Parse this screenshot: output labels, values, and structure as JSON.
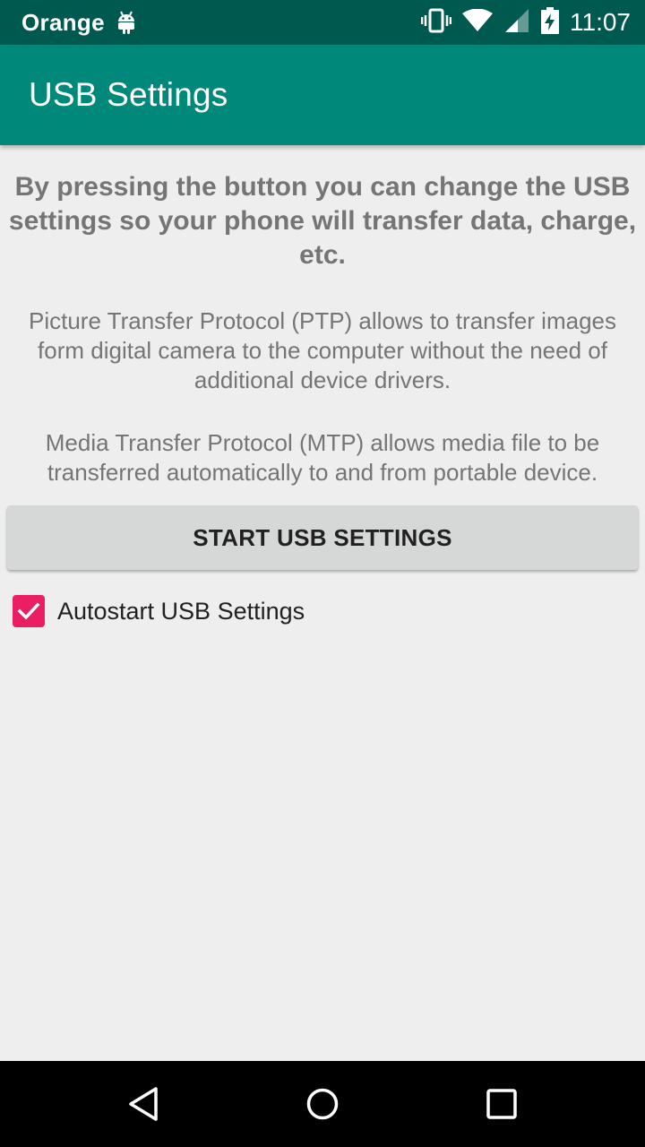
{
  "status_bar": {
    "carrier": "Orange",
    "time": "11:07",
    "icons": [
      "android-notification-icon",
      "vibrate-icon",
      "wifi-icon",
      "signal-icon",
      "battery-charging-icon"
    ]
  },
  "app_bar": {
    "title": "USB Settings",
    "color": "#00897b"
  },
  "content": {
    "headline": "By pressing the button you can change the USB settings so your phone will transfer data, charge, etc.",
    "ptp_text": "Picture Transfer Protocol (PTP) allows to transfer images form digital camera to the computer without the need of additional device drivers.",
    "mtp_text": "Media Transfer Protocol (MTP) allows media file to be transferred automatically to and from portable device."
  },
  "start_button": {
    "label": "START USB SETTINGS"
  },
  "autostart": {
    "label": "Autostart USB Settings",
    "checked": true,
    "accent_color": "#e91e63"
  },
  "nav_bar": {
    "buttons": [
      "back-icon",
      "home-icon",
      "recents-icon"
    ]
  }
}
